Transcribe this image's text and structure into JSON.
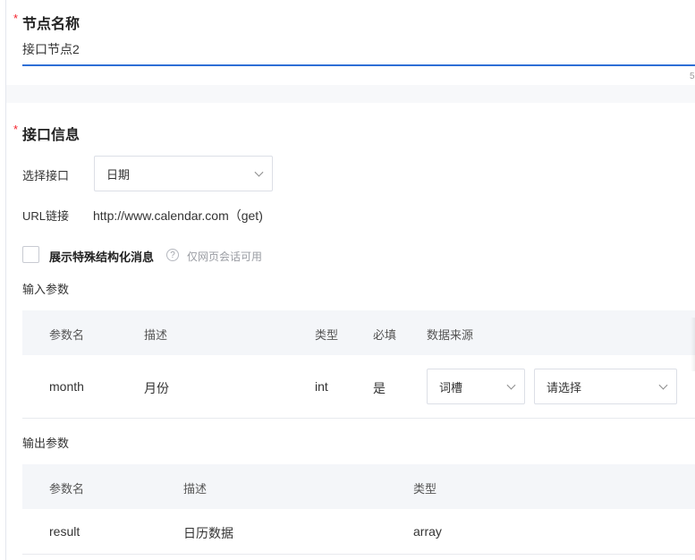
{
  "node_name": {
    "required_mark": "*",
    "title": "节点名称",
    "value": "接口节点2",
    "counter": "5"
  },
  "interface_info": {
    "required_mark": "*",
    "title": "接口信息",
    "select_label": "选择接口",
    "select_value": "日期",
    "url_label": "URL链接",
    "url_value": "http://www.calendar.com（get)",
    "special_message_label": "展示特殊结构化消息",
    "special_message_checked": false,
    "help_icon": "?",
    "special_message_hint": "仅网页会话可用"
  },
  "input_params": {
    "title": "输入参数",
    "headers": [
      "参数名",
      "描述",
      "类型",
      "必填",
      "数据来源"
    ],
    "rows": [
      {
        "name": "month",
        "desc": "月份",
        "type": "int",
        "required": "是",
        "source_select": "词槽",
        "source_detail_placeholder": "请选择"
      }
    ]
  },
  "output_params": {
    "title": "输出参数",
    "headers": [
      "参数名",
      "描述",
      "类型"
    ],
    "rows": [
      {
        "name": "result",
        "desc": "日历数据",
        "type": "array"
      }
    ]
  },
  "colors": {
    "accent": "#2e6fd6",
    "required": "#f5222d",
    "table_header_bg": "#f4f6f9"
  }
}
